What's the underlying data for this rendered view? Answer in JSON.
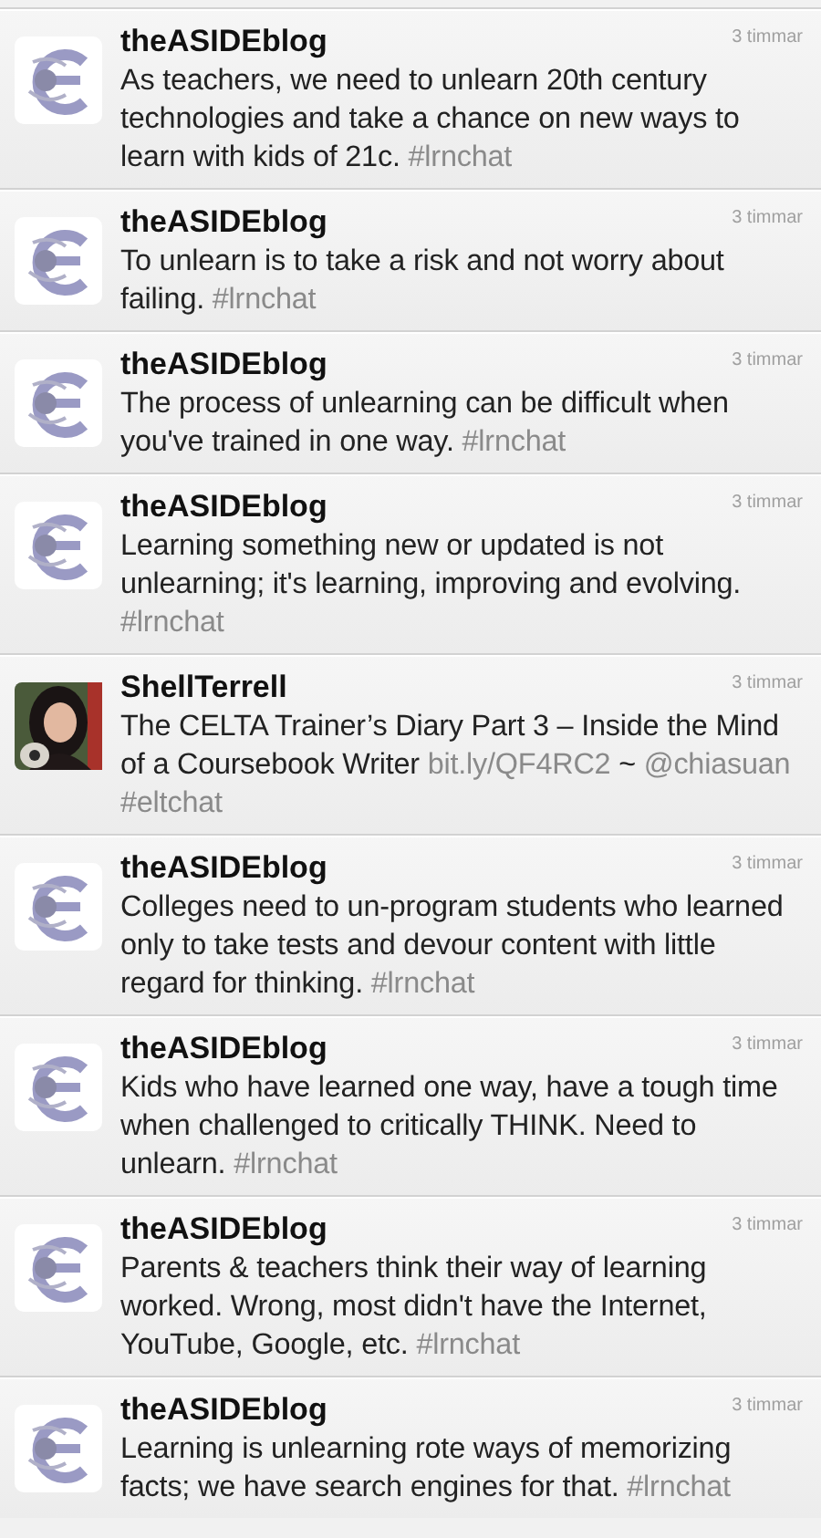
{
  "tweets": [
    {
      "avatar": {
        "kind": "logo"
      },
      "user": "theASIDEblog",
      "time": "3 timmar",
      "body": [
        {
          "kind": "text",
          "text": "As teachers, we need to unlearn 20th century technologies and take a chance on new ways to learn with kids of 21c. "
        },
        {
          "kind": "link",
          "text": "#lrnchat"
        }
      ]
    },
    {
      "avatar": {
        "kind": "logo"
      },
      "user": "theASIDEblog",
      "time": "3 timmar",
      "body": [
        {
          "kind": "text",
          "text": "To unlearn is to take a risk and not worry about failing. "
        },
        {
          "kind": "link",
          "text": "#lrnchat"
        }
      ]
    },
    {
      "avatar": {
        "kind": "logo"
      },
      "user": "theASIDEblog",
      "time": "3 timmar",
      "body": [
        {
          "kind": "text",
          "text": "The process of unlearning can be difficult when you've trained in one way. "
        },
        {
          "kind": "link",
          "text": "#lrnchat"
        }
      ]
    },
    {
      "avatar": {
        "kind": "logo"
      },
      "user": "theASIDEblog",
      "time": "3 timmar",
      "body": [
        {
          "kind": "text",
          "text": "Learning something new or updated is not unlearning; it's learning, improving and evolving. "
        },
        {
          "kind": "link",
          "text": "#lrnchat"
        }
      ]
    },
    {
      "user": "ShellTerrell",
      "time": "3 timmar",
      "body": [
        {
          "kind": "text",
          "text": "The CELTA Trainer’s Diary Part 3 – Inside the Mind of a Coursebook Writer "
        },
        {
          "kind": "link",
          "text": "bit.ly/QF4RC2"
        },
        {
          "kind": "text",
          "text": " ~ "
        },
        {
          "kind": "link",
          "text": "@chiasuan #eltchat"
        }
      ]
    },
    {
      "avatar": {
        "kind": "logo"
      },
      "user": "theASIDEblog",
      "time": "3 timmar",
      "body": [
        {
          "kind": "text",
          "text": "Colleges need to un-program students who learned only to take tests and devour content with little regard for thinking. "
        },
        {
          "kind": "link",
          "text": "#lrnchat"
        }
      ]
    },
    {
      "avatar": {
        "kind": "logo"
      },
      "user": "theASIDEblog",
      "time": "3 timmar",
      "body": [
        {
          "kind": "text",
          "text": "Kids who have learned one way, have a tough time when challenged to critically THINK. Need to unlearn. "
        },
        {
          "kind": "link",
          "text": "#lrnchat"
        }
      ]
    },
    {
      "avatar": {
        "kind": "logo"
      },
      "user": "theASIDEblog",
      "time": "3 timmar",
      "body": [
        {
          "kind": "text",
          "text": "Parents & teachers think their way of learning worked. Wrong, most didn't have the Internet, YouTube, Google, etc. "
        },
        {
          "kind": "link",
          "text": "#lrnchat"
        }
      ]
    },
    {
      "avatar": {
        "kind": "logo"
      },
      "user": "theASIDEblog",
      "time": "3 timmar",
      "body": [
        {
          "kind": "text",
          "text": "Learning is unlearning rote ways of memorizing facts; we have search engines for that. "
        },
        {
          "kind": "link",
          "text": "#lrnchat"
        }
      ]
    }
  ]
}
